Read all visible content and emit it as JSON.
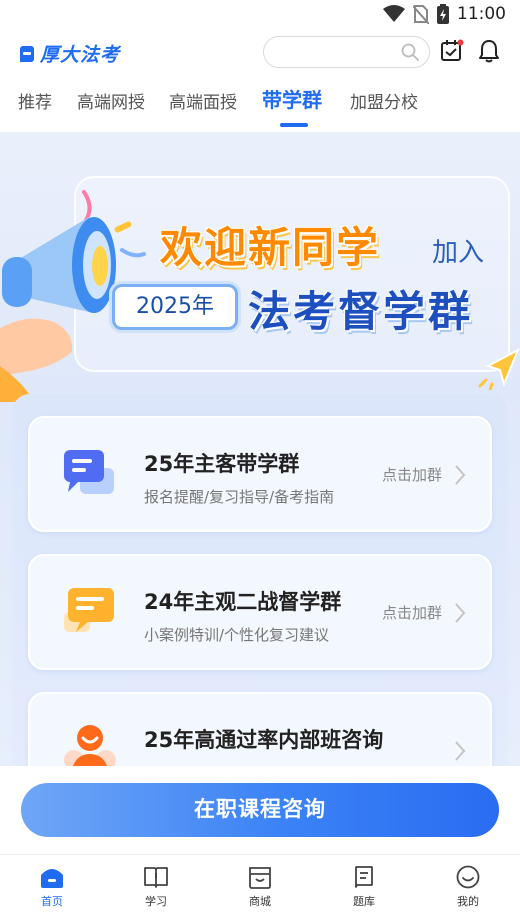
{
  "status_bar": {
    "time": "11:00"
  },
  "header": {
    "logo_text": "厚大法考",
    "search": {
      "placeholder": ""
    }
  },
  "tabs": [
    {
      "label": "推荐",
      "active": false
    },
    {
      "label": "高端网授",
      "active": false
    },
    {
      "label": "高端面授",
      "active": false
    },
    {
      "label": "带学群",
      "active": true
    },
    {
      "label": "加盟分校",
      "active": false
    }
  ],
  "banner": {
    "headline": "欢迎新同学",
    "join": "加入",
    "year": "2025年",
    "group": "法考督学群"
  },
  "cards": [
    {
      "title": "25年主客带学群",
      "subtitle": "报名提醒/复习指导/备考指南",
      "action": "点击加群"
    },
    {
      "title": "24年主观二战督学群",
      "subtitle": "小案例特训/个性化复习建议",
      "action": "点击加群"
    },
    {
      "title": "25年高通过率内部班咨询",
      "subtitle": "",
      "action": ""
    }
  ],
  "cta": {
    "label": "在职课程咨询"
  },
  "bottom_nav": [
    {
      "label": "首页",
      "icon": "home-icon",
      "active": true
    },
    {
      "label": "学习",
      "icon": "book-icon",
      "active": false
    },
    {
      "label": "商城",
      "icon": "shop-icon",
      "active": false
    },
    {
      "label": "题库",
      "icon": "question-bank-icon",
      "active": false
    },
    {
      "label": "我的",
      "icon": "profile-icon",
      "active": false
    }
  ],
  "colors": {
    "primary": "#1f6cf0",
    "headline_orange": "#ff8a00",
    "group_blue": "#1e4fbf"
  }
}
